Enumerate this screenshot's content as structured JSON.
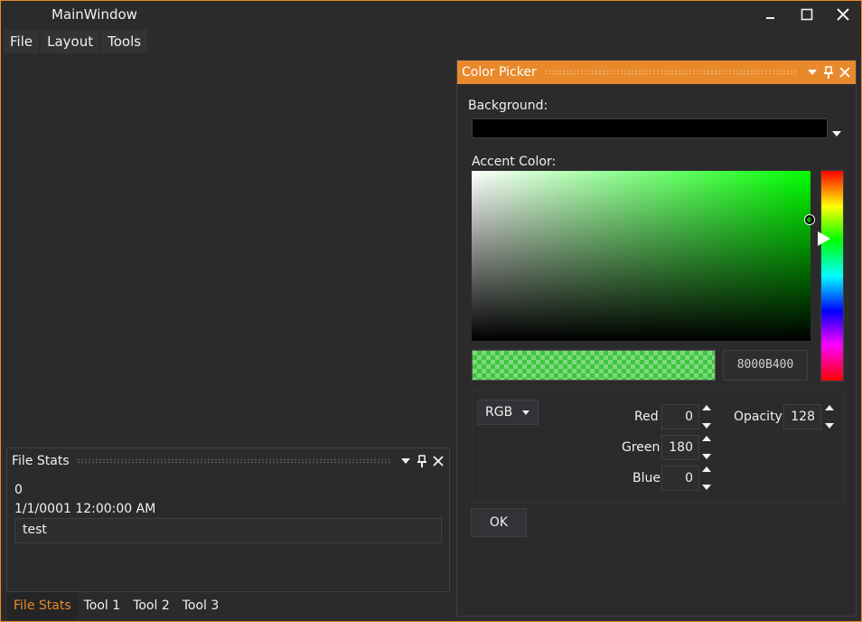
{
  "window": {
    "title": "MainWindow"
  },
  "menu": {
    "items": [
      "File",
      "Layout",
      "Tools"
    ]
  },
  "file_stats": {
    "title": "File Stats",
    "count": "0",
    "date": "1/1/0001 12:00:00 AM",
    "textbox_value": "test"
  },
  "bottom_tabs": [
    "File Stats",
    "Tool 1",
    "Tool 2",
    "Tool 3"
  ],
  "color_picker": {
    "title": "Color Picker",
    "background_label": "Background:",
    "background_color": "#000000",
    "accent_label": "Accent Color:",
    "hex_value": "8000B400",
    "mode": "RGB",
    "red_label": "Red",
    "red_value": "0",
    "green_label": "Green",
    "green_value": "180",
    "blue_label": "Blue",
    "blue_value": "0",
    "opacity_label": "Opacity",
    "opacity_value": "128",
    "ok_label": "OK"
  },
  "colors": {
    "accent": "#e8892b",
    "hue_green": "#00ff00",
    "selected_color": "#00b400"
  }
}
